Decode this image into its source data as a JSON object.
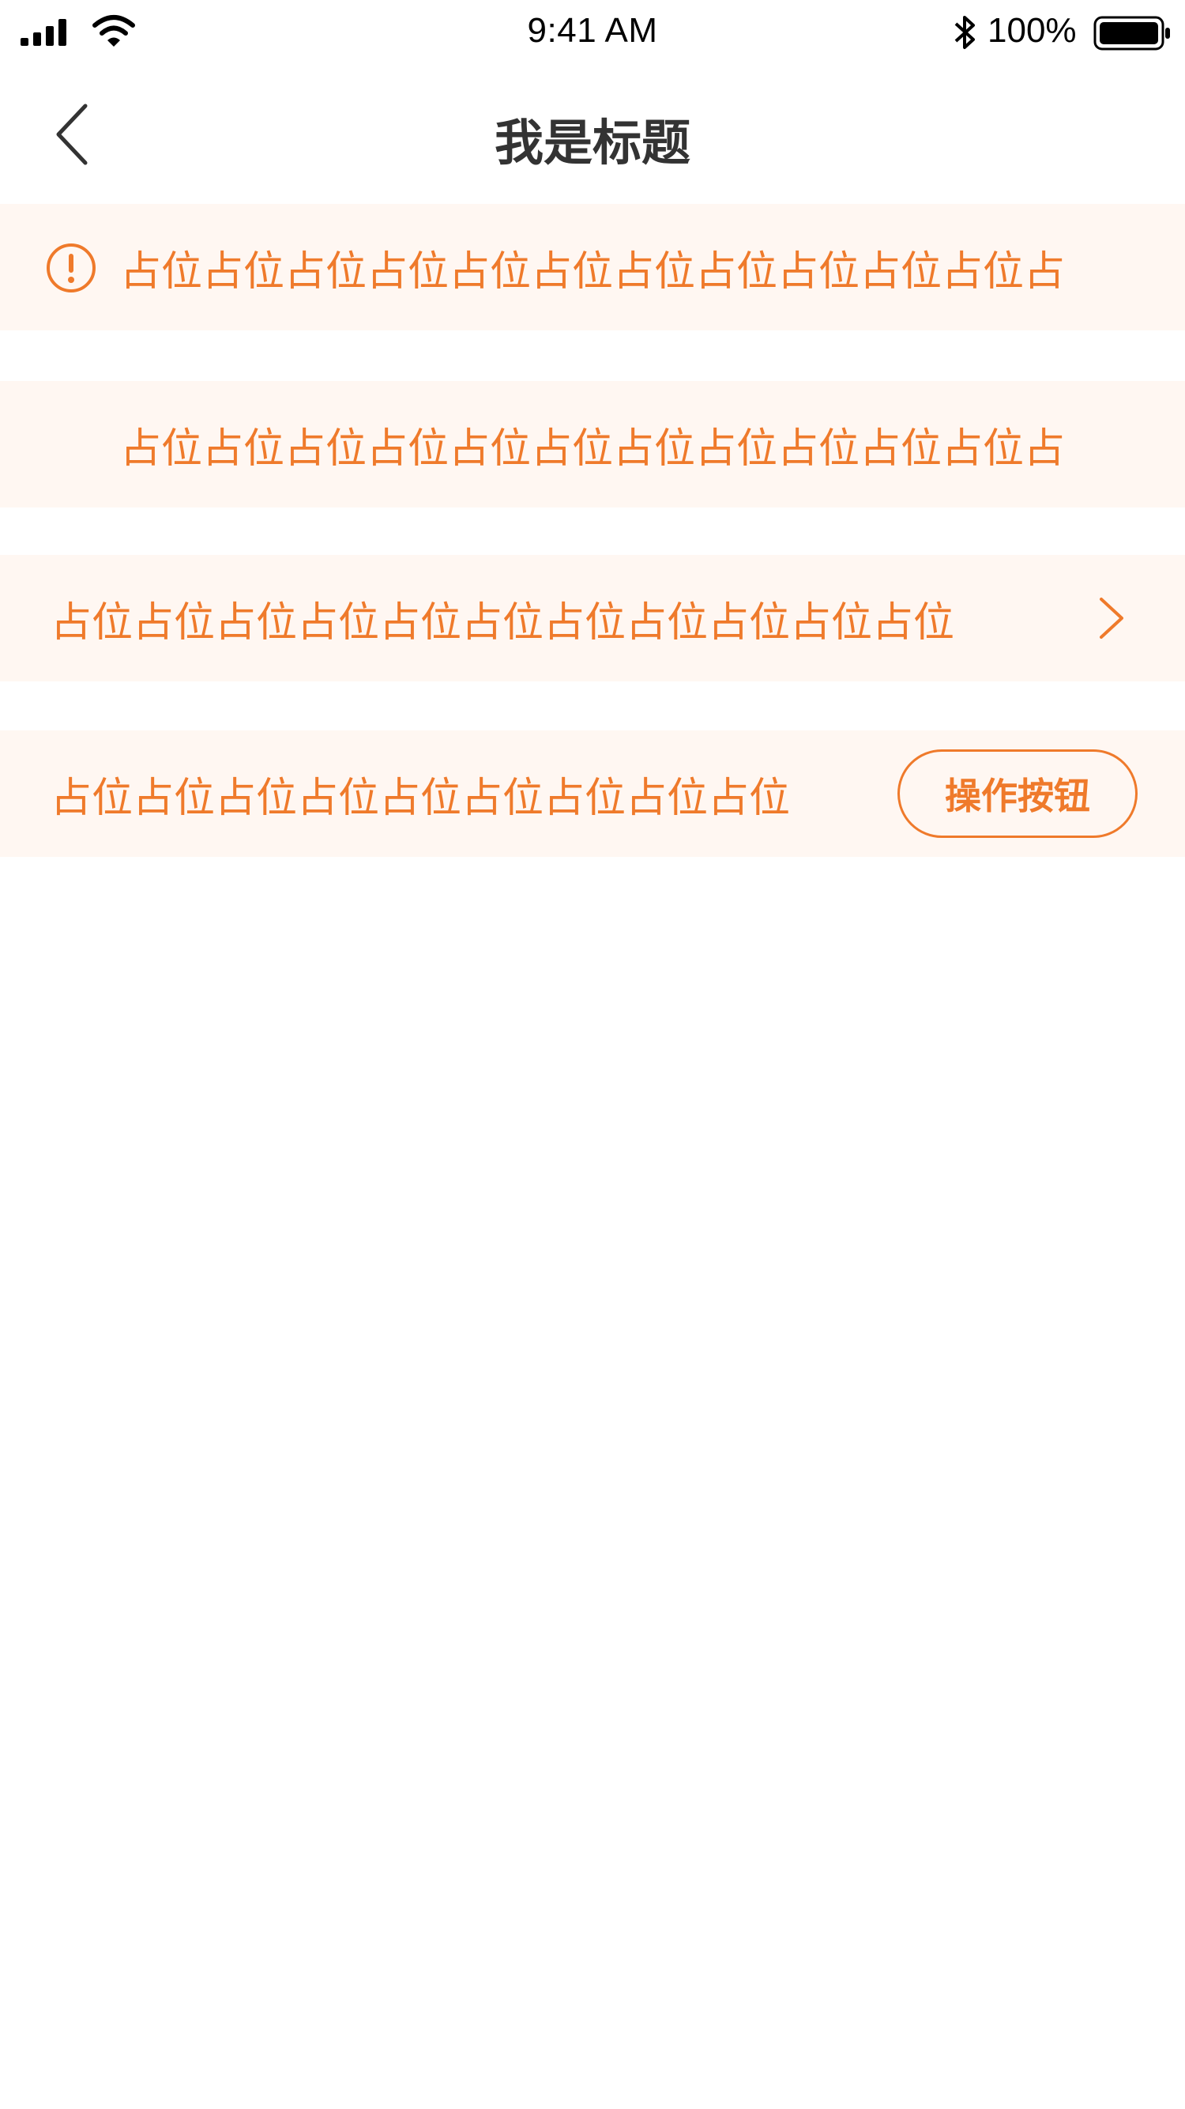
{
  "status_bar": {
    "time": "9:41 AM",
    "battery_percent": "100%",
    "icons": [
      "signal-icon",
      "wifi-icon",
      "bluetooth-icon",
      "battery-icon"
    ]
  },
  "nav": {
    "title": "我是标题",
    "back_icon": "chevron-left-icon"
  },
  "notices": [
    {
      "icon": "alert-circle-icon",
      "text": "占位占位占位占位占位占位占位占位占位占位占位占"
    },
    {
      "text": "占位占位占位占位占位占位占位占位占位占位占位占"
    },
    {
      "text": "占位占位占位占位占位占位占位占位占位占位占位",
      "trailing_icon": "chevron-right-icon"
    },
    {
      "text": "占位占位占位占位占位占位占位占位占位",
      "button_label": "操作按钮"
    }
  ],
  "colors": {
    "accent": "#ef7a2b",
    "notice_bg": "#fff7f2",
    "title": "#333333",
    "background": "#ffffff"
  }
}
